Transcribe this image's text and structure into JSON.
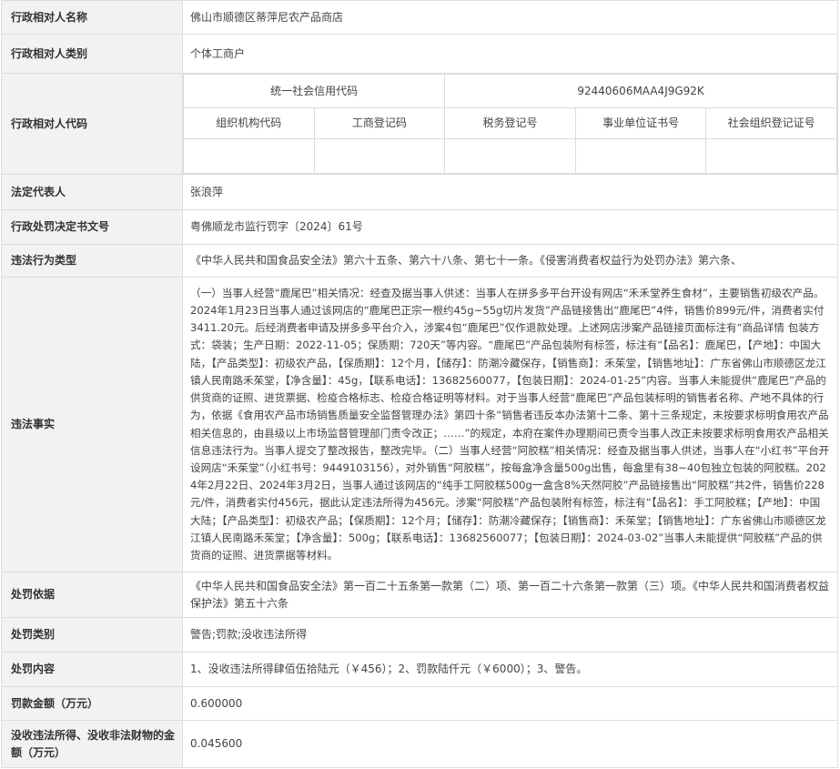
{
  "rows": {
    "name": {
      "label": "行政相对人名称",
      "value": "佛山市顺德区蒂萍尼农产品商店"
    },
    "category": {
      "label": "行政相对人类别",
      "value": "个体工商户"
    },
    "code": {
      "label": "行政相对人代码",
      "credit_code_label": "统一社会信用代码",
      "credit_code_value": "92440606MAA4J9G92K",
      "sub_headers": [
        "组织机构代码",
        "工商登记码",
        "税务登记号",
        "事业单位证书号",
        "社会组织登记证号"
      ],
      "sub_values": [
        "",
        "",
        "",
        "",
        ""
      ]
    },
    "legal_rep": {
      "label": "法定代表人",
      "value": "张浪萍"
    },
    "doc_no": {
      "label": "行政处罚决定书文号",
      "value": "粤佛顺龙市监行罚字〔2024〕61号"
    },
    "violation_type": {
      "label": "违法行为类型",
      "value": "《中华人民共和国食品安全法》第六十五条、第六十八条、第七十一条。《侵害消费者权益行为处罚办法》第六条、"
    },
    "facts": {
      "label": "违法事实",
      "value": "（一）当事人经营“鹿尾巴”相关情况：经查及据当事人供述：当事人在拼多多平台开设有网店“禾禾堂养生食材”，主要销售初级农产品。2024年1月23日当事人通过该网店的“鹿尾巴正宗一根约45g~55g切片发货”产品链接售出“鹿尾巴”4件，销售价899元/件，消费者实付3411.20元。后经消费者申请及拼多多平台介入，涉案4包“鹿尾巴”仅作退款处理。上述网店涉案产品链接页面标注有“商品详情 包装方式：袋装；生产日期：2022-11-05；保质期：720天”等内容。“鹿尾巴”产品包装附有标签，标注有“【品名】：鹿尾巴，【产地】：中国大陆，【产品类型】：初级农产品，【保质期】：12个月，【储存】：防潮冷藏保存，【销售商】：禾茱堂，【销售地址】：广东省佛山市顺德区龙江镇人民南路禾茱堂，【净含量】：45g，【联系电话】：13682560077，【包装日期】：2024-01-25”内容。当事人未能提供“鹿尾巴”产品的供货商的证照、进货票据、检疫合格标志、检疫合格证明等材料。对于当事人经营“鹿尾巴”产品包装标明的销售者名称、产地不具体的行为，依据《食用农产品市场销售质量安全监督管理办法》第四十条“销售者违反本办法第十二条、第十三条规定，未按要求标明食用农产品相关信息的，由县级以上市场监督管理部门责令改正；……”的规定，本府在案件办理期间已责令当事人改正未按要求标明食用农产品相关信息违法行为。当事人提交了整改报告，整改完毕。（二）当事人经营“阿胶糕”相关情况：经查及据当事人供述，当事人在“小红书”平台开设网店“禾茱堂”（小红书号：9449103156），对外销售“阿胶糕”，按每盒净含量500g出售，每盒里有38~40包独立包装的阿胶糕。2024年2月22日、2024年3月2日，当事人通过该网店的“纯手工阿胶糕500g一盒含8%天然阿胶”产品链接售出“阿胶糕”共2件，销售价228元/件，消费者实付456元，据此认定违法所得为456元。涉案“阿胶糕”产品包装附有标签，标注有“【品名】：手工阿胶糕；【产地】：中国大陆；【产品类型】：初级农产品；【保质期】：12个月；【储存】：防潮冷藏保存；【销售商】：禾茱堂；【销售地址】：广东省佛山市顺德区龙江镇人民南路禾茱堂；【净含量】：500g；【联系电话】：13682560077；【包装日期】：2024-03-02”当事人未能提供“阿胶糕”产品的供货商的证照、进货票据等材料。"
    },
    "basis": {
      "label": "处罚依据",
      "value": "《中华人民共和国食品安全法》第一百二十五条第一款第（二）项、第一百二十六条第一款第（三）项。《中华人民共和国消费者权益保护法》第五十六条"
    },
    "penalty_type": {
      "label": "处罚类别",
      "value": "警告;罚款;没收违法所得"
    },
    "penalty_content": {
      "label": "处罚内容",
      "value": "1、没收违法所得肆佰伍拾陆元（￥456）；2、罚款陆仟元（￥6000）；3、警告。"
    },
    "fine": {
      "label": "罚款金额（万元）",
      "value": "0.600000"
    },
    "confiscation": {
      "label": "没收违法所得、没收非法财物的金额（万元）",
      "value": "0.045600"
    }
  }
}
